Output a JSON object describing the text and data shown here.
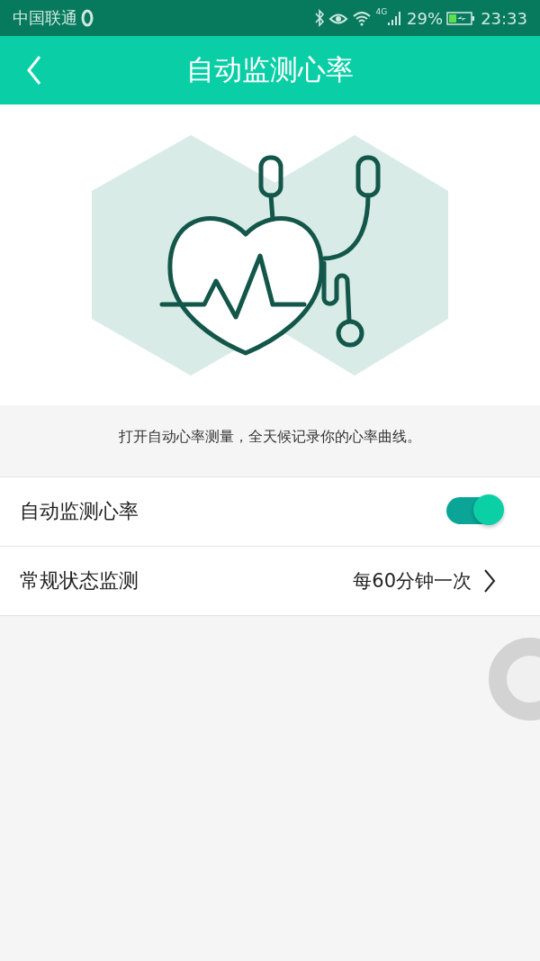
{
  "status_bar": {
    "carrier": "中国联通",
    "network": "4G",
    "battery": "29%",
    "time": "23:33"
  },
  "header": {
    "title": "自动监测心率"
  },
  "caption": "打开自动心率测量，全天候记录你的心率曲线。",
  "settings": [
    {
      "kind": "toggle",
      "label": "自动监测心率",
      "on": true
    },
    {
      "kind": "link",
      "label": "常规状态监测",
      "value": "每60分钟一次"
    }
  ]
}
